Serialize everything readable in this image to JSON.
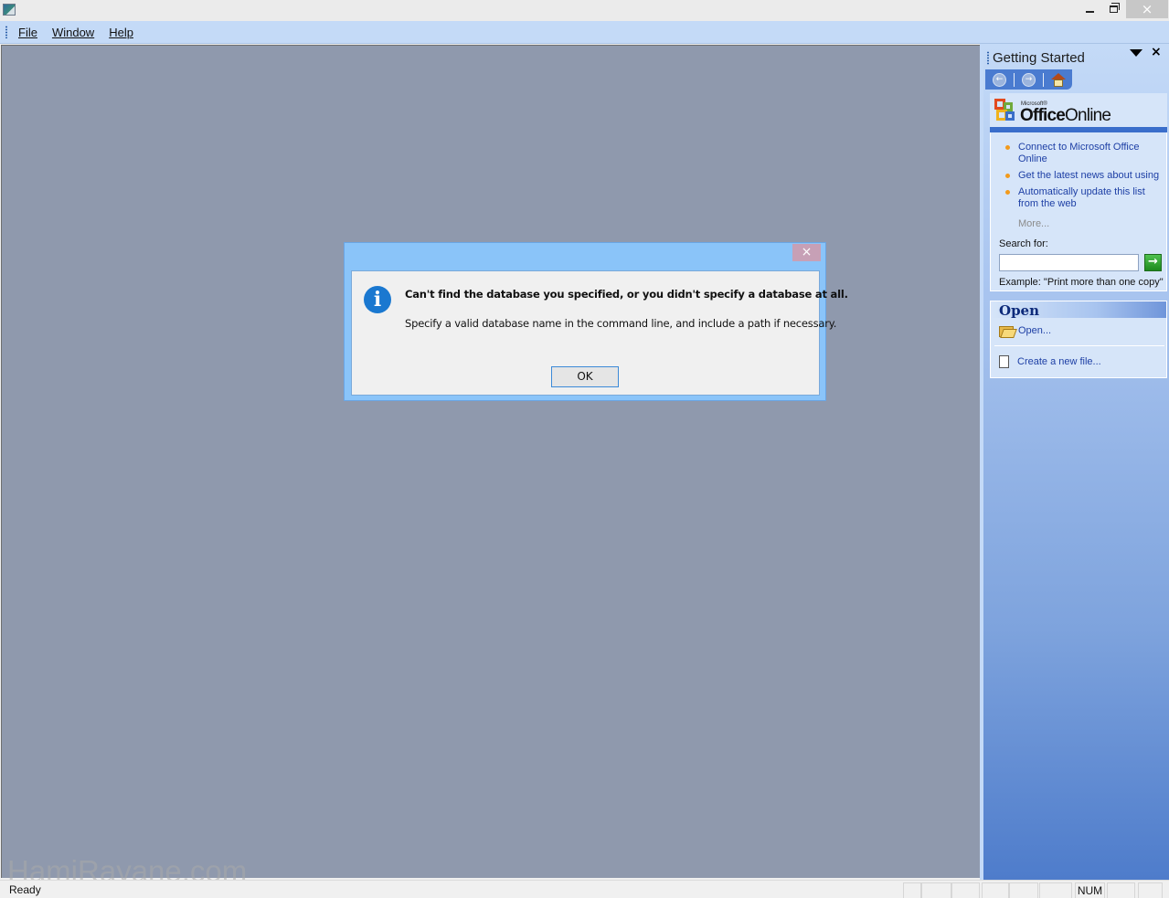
{
  "window": {
    "title": "",
    "controls": {
      "minimize": "minimize",
      "maximize": "restore",
      "close": "×"
    }
  },
  "menubar": {
    "items": [
      {
        "label": "File",
        "accel": "F"
      },
      {
        "label": "Window",
        "accel": "W"
      },
      {
        "label": "Help",
        "accel": "H"
      }
    ]
  },
  "taskpane": {
    "title": "Getting Started",
    "close_label": "×",
    "toolbar": {
      "back_icon": "back-arrow-icon",
      "forward_icon": "forward-arrow-icon",
      "home_icon": "home-icon"
    },
    "logo": {
      "small_text": "Microsoft®",
      "brand_bold": "Office",
      "brand_rest": "Online"
    },
    "online_links": [
      "Connect to Microsoft Office Online",
      "Get the latest news about using",
      "Automatically update this list from the web"
    ],
    "more_label": "More...",
    "search": {
      "label": "Search for:",
      "value": "",
      "placeholder": "",
      "go_label": "→",
      "example": "Example:  \"Print more than one copy\""
    },
    "open_section": {
      "title": "Open",
      "items": [
        {
          "label": "Open...",
          "icon": "folder-open-icon"
        },
        {
          "label": "Create a new file...",
          "icon": "new-file-icon"
        }
      ]
    }
  },
  "dialog": {
    "close_label": "×",
    "icon": "info-icon",
    "main_message": "Can't find the database you specified, or you didn't specify a database at all.",
    "sub_message": "Specify a valid database name in the command line, and include a path if necessary.",
    "ok_label": "OK"
  },
  "statusbar": {
    "text": "Ready",
    "indicators": [
      "",
      "",
      "",
      "",
      "",
      "",
      "NUM",
      "",
      ""
    ]
  },
  "watermark": "HamiRayane.com"
}
